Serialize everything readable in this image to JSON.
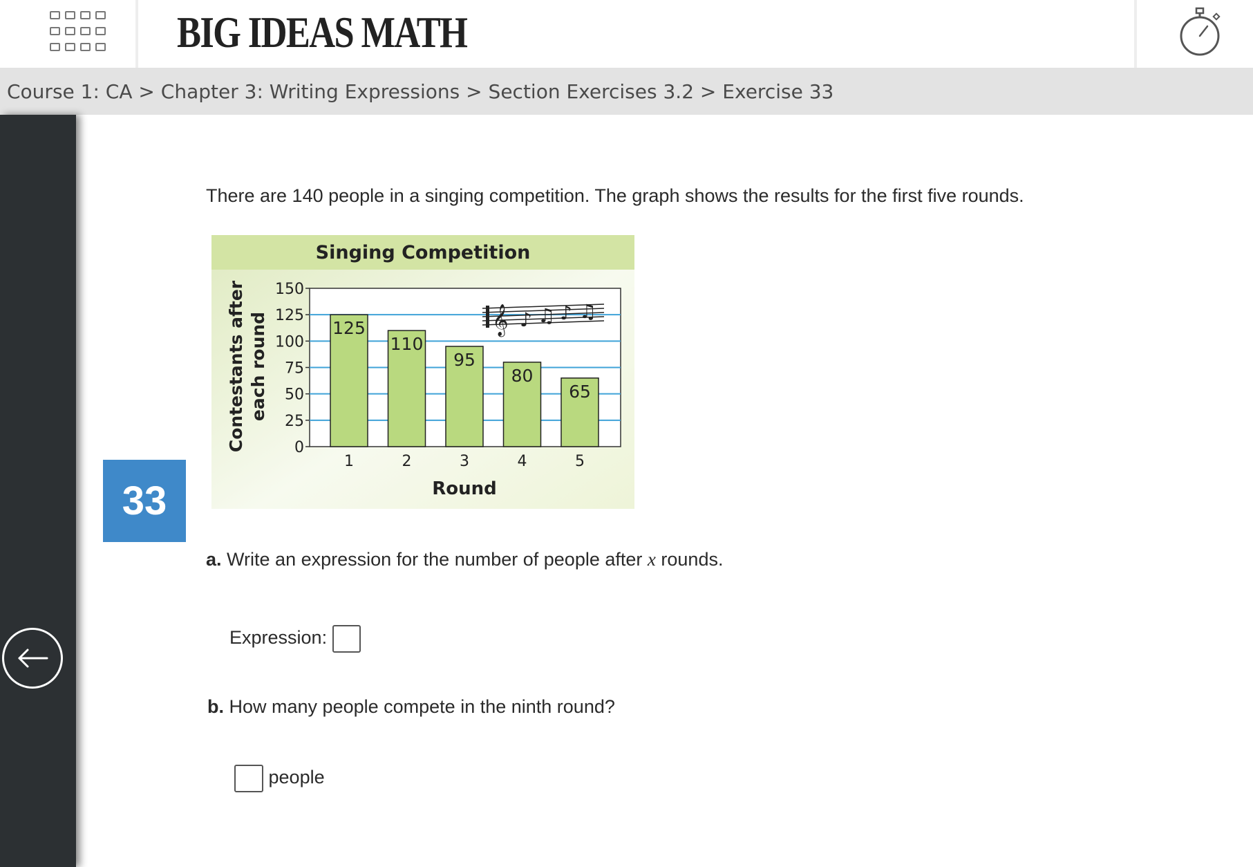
{
  "header": {
    "logo_text": "BIG IDEAS MATH",
    "apps_icon": "grid-apps-icon",
    "timer_icon": "stopwatch-icon"
  },
  "breadcrumb": {
    "items": [
      "Course 1: CA",
      "Chapter 3: Writing Expressions",
      "Section Exercises 3.2",
      "Exercise 33"
    ],
    "separator": ">"
  },
  "sidebar": {
    "back_icon": "arrow-left-icon"
  },
  "exercise": {
    "number": "33",
    "prompt": "There are 140 people in a singing competition. The graph shows the results for the first five rounds.",
    "part_a": {
      "letter": "a.",
      "text_before": "Write an expression for the number of people after",
      "variable": "x",
      "text_after": "rounds.",
      "answer_label": "Expression:",
      "answer_value": ""
    },
    "part_b": {
      "letter": "b.",
      "text": "How many people compete in the ninth round?",
      "answer_value": "",
      "unit": "people"
    }
  },
  "chart_data": {
    "type": "bar",
    "title": "Singing Competition",
    "xlabel": "Round",
    "ylabel_lines": [
      "Contestants after",
      "each round"
    ],
    "categories": [
      "1",
      "2",
      "3",
      "4",
      "5"
    ],
    "values": [
      125,
      110,
      95,
      80,
      65
    ],
    "data_labels": [
      "125",
      "110",
      "95",
      "80",
      "65"
    ],
    "ylim": [
      0,
      150
    ],
    "yticks": [
      0,
      25,
      50,
      75,
      100,
      125,
      150
    ],
    "grid": true,
    "decoration_icon": "music-notes-icon",
    "colors": {
      "bar": "#b9d97f",
      "title_band": "#d3e4a4",
      "gridline": "#3fa3d8",
      "background": "#f4f8e8"
    }
  },
  "colors": {
    "badge": "#3f89c9",
    "sidebar": "#2c3033",
    "breadcrumb_bg": "#e3e3e3"
  }
}
